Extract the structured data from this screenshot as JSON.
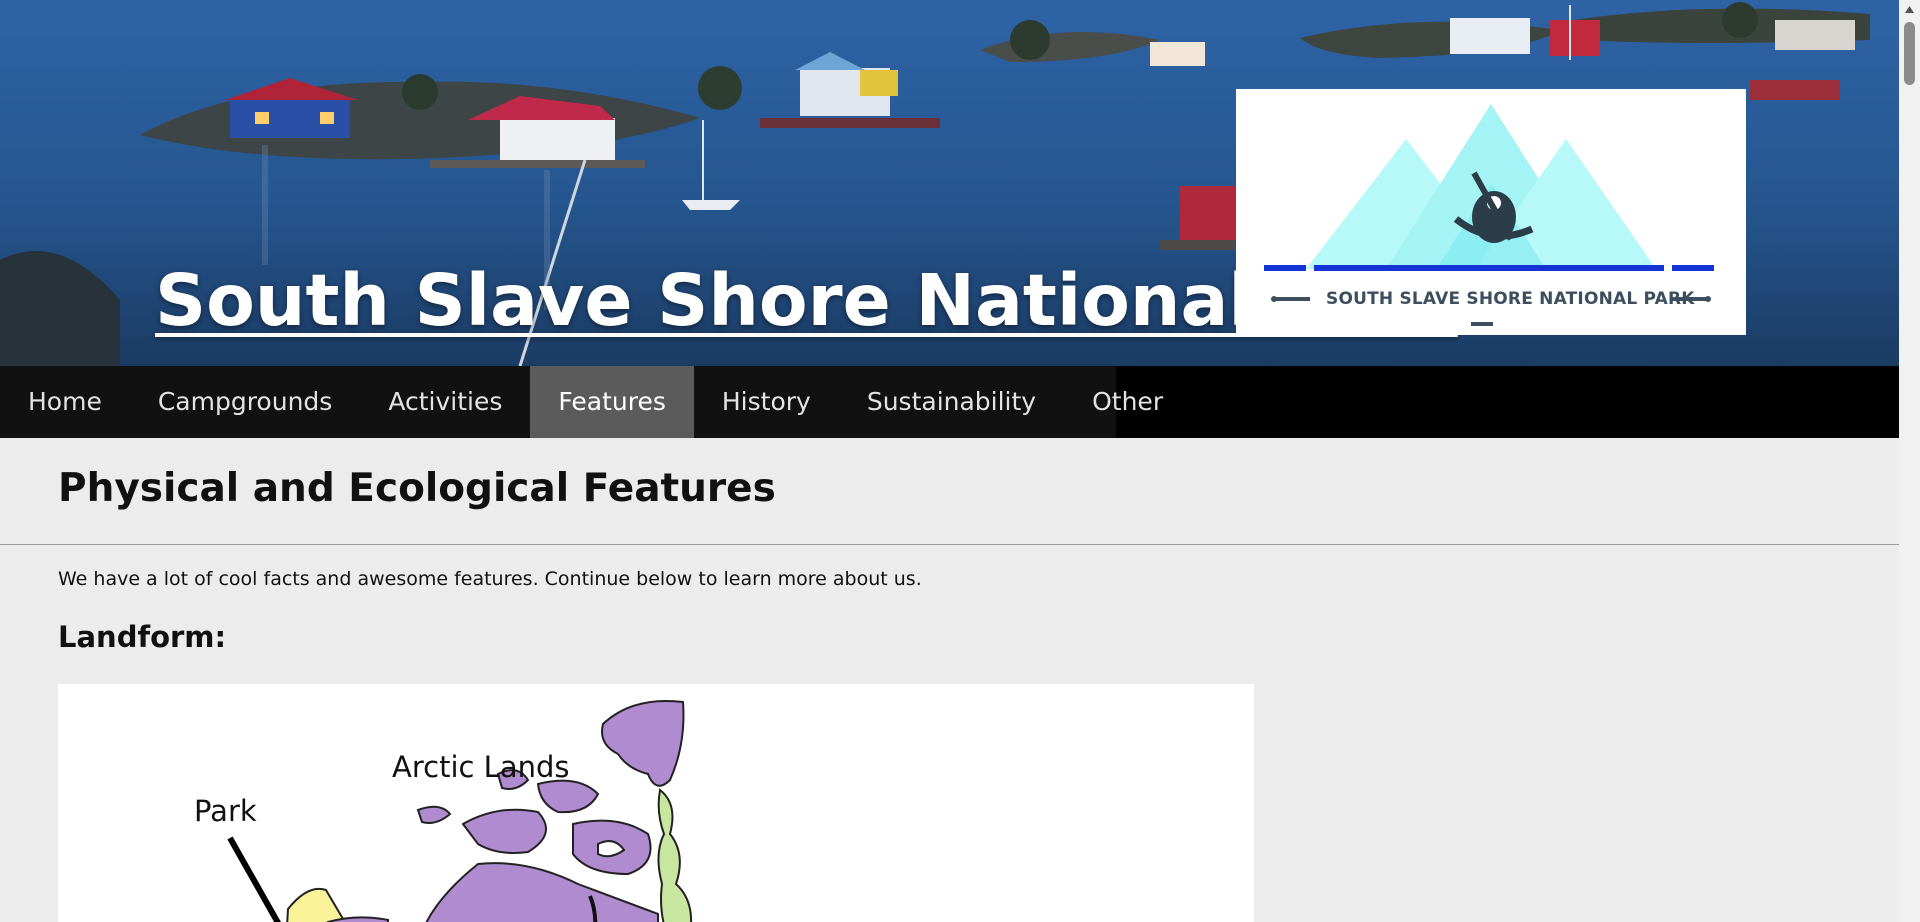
{
  "header": {
    "site_title": "South Slave Shore National Park",
    "logo_text": "SOUTH SLAVE SHORE NATIONAL PARK"
  },
  "nav": {
    "items": [
      {
        "label": "Home",
        "active": false
      },
      {
        "label": "Campgrounds",
        "active": false
      },
      {
        "label": "Activities",
        "active": false
      },
      {
        "label": "Features",
        "active": true
      },
      {
        "label": "History",
        "active": false
      },
      {
        "label": "Sustainability",
        "active": false
      },
      {
        "label": "Other",
        "active": false
      }
    ]
  },
  "main": {
    "heading": "Physical and Ecological Features",
    "intro": "We have a lot of cool facts and awesome features. Continue below to learn more about us.",
    "landform_heading": "Landform:",
    "map": {
      "label_region": "Arctic Lands",
      "label_park": "Park"
    }
  },
  "colors": {
    "nav_bg": "#000000",
    "nav_active": "#5b5b5b",
    "page_bg": "#ececec",
    "lake_blue": "#2b5f9c",
    "logo_mountain": "#9ff5f6",
    "logo_bar": "#1434d6",
    "map_purple": "#b08bd0",
    "map_green": "#c8e6a0",
    "map_yellow": "#fbf39a"
  }
}
